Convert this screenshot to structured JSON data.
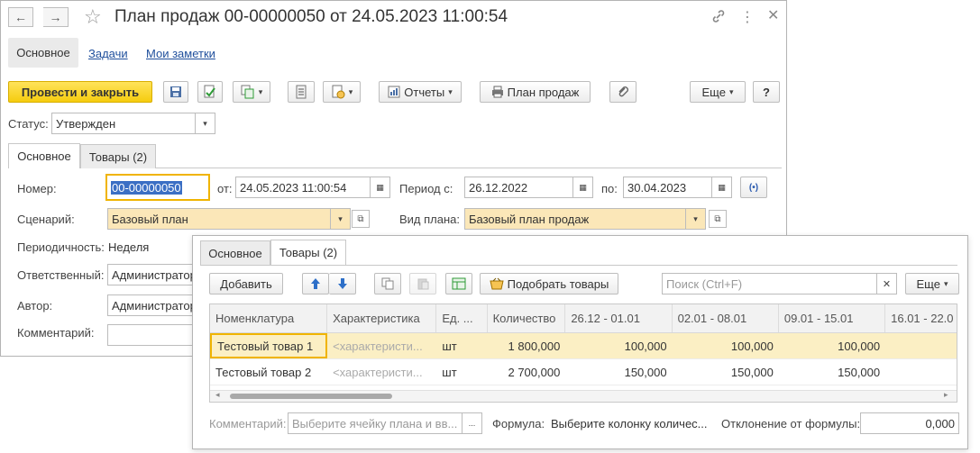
{
  "window": {
    "title": "План продаж 00-00000050 от 24.05.2023 11:00:54",
    "back_glyph": "←",
    "forward_glyph": "→",
    "star_glyph": "☆",
    "link_glyph": "🔗",
    "more_glyph": "⋮",
    "restore_glyph": "▢",
    "close_glyph": "✕"
  },
  "sections": {
    "main": "Основное",
    "tasks": "Задачи",
    "notes": "Мои заметки"
  },
  "toolbar": {
    "post_close": "Провести и закрыть",
    "reports": "Отчеты",
    "sales_plan": "План продаж",
    "more": "Еще",
    "help": "?"
  },
  "status": {
    "label": "Статус:",
    "value": "Утвержден"
  },
  "tabs": {
    "main": "Основное",
    "goods": "Товары (2)"
  },
  "form": {
    "number_label": "Номер:",
    "number_value": "00-00000050",
    "from_label": "от:",
    "date_value": "24.05.2023 11:00:54",
    "period_label": "Период с:",
    "period_from": "26.12.2022",
    "period_to_label": "по:",
    "period_to": "30.04.2023",
    "scenario_label": "Сценарий:",
    "scenario_value": "Базовый план",
    "plan_type_label": "Вид плана:",
    "plan_type_value": "Базовый план продаж",
    "periodicity_label": "Периодичность:",
    "periodicity_value": "Неделя",
    "responsible_label": "Ответственный:",
    "responsible_value": "Администратор",
    "author_label": "Автор:",
    "author_value": "Администратор",
    "comment_label": "Комментарий:",
    "comment_value": ""
  },
  "goods": {
    "add": "Добавить",
    "pick": "Подобрать товары",
    "search_placeholder": "Поиск (Ctrl+F)",
    "more": "Еще",
    "columns": [
      "Номенклатура",
      "Характеристика",
      "Ед. ...",
      "Количество",
      "26.12 - 01.01",
      "02.01 - 08.01",
      "09.01 - 15.01",
      "16.01 - 22.0"
    ],
    "rows": [
      {
        "name": "Тестовый товар 1",
        "char": "<характеристи...",
        "unit": "шт",
        "qty": "1 800,000",
        "w1": "100,000",
        "w2": "100,000",
        "w3": "100,000"
      },
      {
        "name": "Тестовый товар 2",
        "char": "<характеристи...",
        "unit": "шт",
        "qty": "2 700,000",
        "w1": "150,000",
        "w2": "150,000",
        "w3": "150,000"
      }
    ],
    "comment_label": "Комментарий:",
    "comment_placeholder": "Выберите ячейку плана и вв...",
    "formula_label": "Формула:",
    "formula_value": "Выберите колонку количес...",
    "deviation_label": "Отклонение от формулы:",
    "deviation_value": "0,000"
  },
  "colors": {
    "primary_button": "#f5cc0f",
    "required_field": "#fbe7b8",
    "selected_row": "#fbefc4",
    "link": "#1f4f9c"
  }
}
